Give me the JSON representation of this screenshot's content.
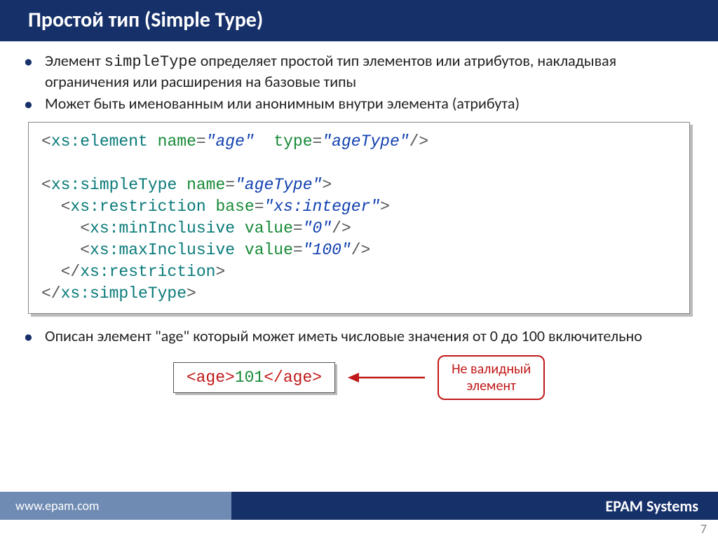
{
  "title": "Простой тип (Simple Type)",
  "bullets_a": [
    "Элемент simpleType определяет простой тип элементов или атрибутов, накладывая ограничения или расширения на базовые типы",
    "Может быть именованным или анонимным внутри элемента (атрибута)"
  ],
  "bullet_a0_pre": "Элемент ",
  "bullet_a0_mono": "simpleType",
  "bullet_a0_post": " определяет простой тип элементов или атрибутов, накладывая ограничения или расширения на базовые типы",
  "code": {
    "l1": {
      "tag": "xs:element",
      "a1n": "name",
      "a1v": "\"age\"",
      "a2n": "type",
      "a2v": "\"ageType\""
    },
    "l2": {
      "tag": "xs:simpleType",
      "a1n": "name",
      "a1v": "\"ageType\""
    },
    "l3": {
      "tag": "xs:restriction",
      "a1n": "base",
      "a1v": "\"xs:integer\""
    },
    "l4": {
      "tag": "xs:minInclusive",
      "a1n": "value",
      "a1v": "\"0\""
    },
    "l5": {
      "tag": "xs:maxInclusive",
      "a1n": "value",
      "a1v": "\"100\""
    },
    "c1": "xs:restriction",
    "c2": "xs:simpleType"
  },
  "bullets_b0": "Описан элемент  \"age\"  который может иметь числовые значения от 0 до 100 включительно",
  "invalid": {
    "open": "<age>",
    "val": "101",
    "close": "</age>"
  },
  "callout_l1": "Не валидный",
  "callout_l2": "элемент",
  "footer_left": "www.epam.com",
  "footer_right": "EPAM Systems",
  "page": "7"
}
